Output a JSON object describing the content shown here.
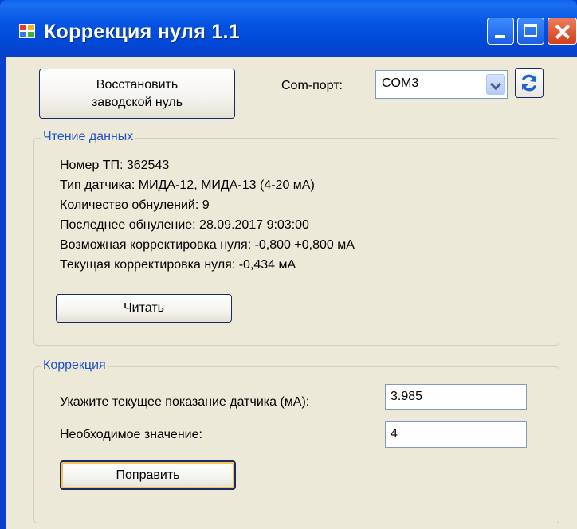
{
  "window": {
    "title": "Коррекция нуля 1.1"
  },
  "toolbar": {
    "restore_line1": "Восстановить",
    "restore_line2": "заводской нуль",
    "port_label": "Com-порт:",
    "port_value": "COM3"
  },
  "reading": {
    "group_title": "Чтение данных",
    "lines": [
      "Номер ТП: 362543",
      "Тип датчика: МИДА-12, МИДА-13 (4-20 мА)",
      "Количество обнулений: 9",
      "Последнее обнуление: 28.09.2017 9:03:00",
      "Возможная корректировка нуля: -0,800 +0,800 мА",
      "Текущая корректировка нуля: -0,434 мА"
    ],
    "read_button": "Читать"
  },
  "correction": {
    "group_title": "Коррекция",
    "current_label": "Укажите текущее показание датчика (мА):",
    "current_value": "3.985",
    "required_label": "Необходимое значение:",
    "required_value": "4",
    "fix_button": "Поправить"
  },
  "icons": {
    "app": "app-icon",
    "minimize": "minimize-icon",
    "maximize": "maximize-icon",
    "close": "close-icon",
    "refresh": "refresh-icon",
    "dropdown": "chevron-down-icon"
  }
}
